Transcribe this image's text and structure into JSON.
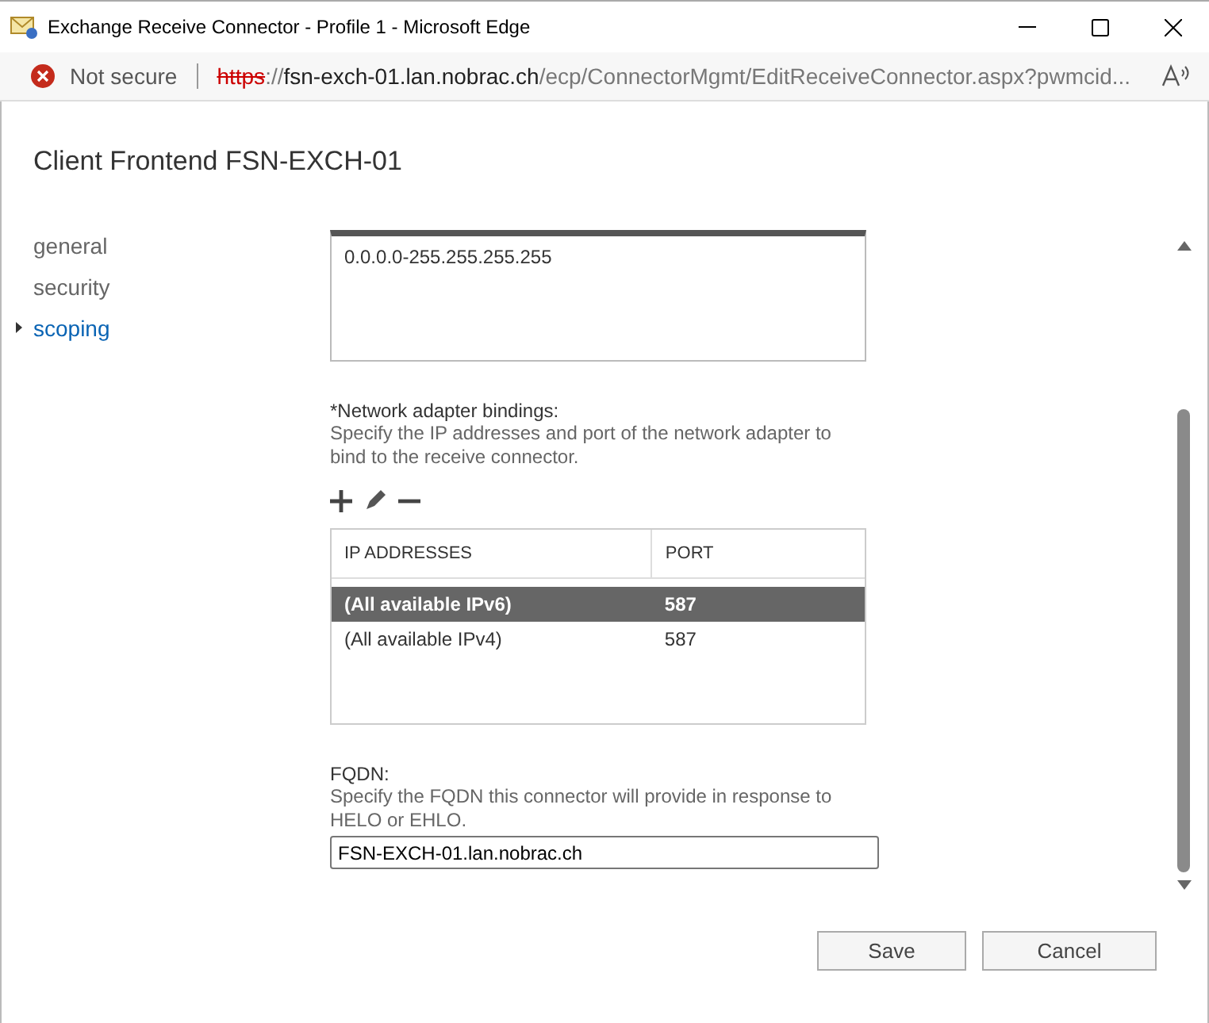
{
  "window": {
    "title": "Exchange Receive Connector - Profile 1 - Microsoft Edge"
  },
  "address_bar": {
    "security": "Not secure",
    "scheme": "https",
    "separator": "://",
    "host": "fsn-exch-01.lan.nobrac.ch",
    "path": "/ecp/ConnectorMgmt/EditReceiveConnector.aspx?pwmcid..."
  },
  "heading": "Client Frontend FSN-EXCH-01",
  "nav": [
    {
      "label": "general",
      "selected": false
    },
    {
      "label": "security",
      "selected": false
    },
    {
      "label": "scoping",
      "selected": true
    }
  ],
  "remote_ranges": [
    "0.0.0.0-255.255.255.255"
  ],
  "bindings": {
    "label": "*Network adapter bindings:",
    "description": "Specify the IP addresses and port of the network adapter to bind to the receive connector.",
    "columns": [
      "IP ADDRESSES",
      "PORT"
    ],
    "rows": [
      {
        "cells": [
          "(All available IPv6)",
          "587"
        ],
        "selected": true
      },
      {
        "cells": [
          "(All available IPv4)",
          "587"
        ],
        "selected": false
      }
    ]
  },
  "fqdn": {
    "label": "FQDN:",
    "description": "Specify the FQDN this connector will provide in response to HELO or EHLO.",
    "value": "FSN-EXCH-01.lan.nobrac.ch"
  },
  "buttons": [
    "Save",
    "Cancel"
  ]
}
